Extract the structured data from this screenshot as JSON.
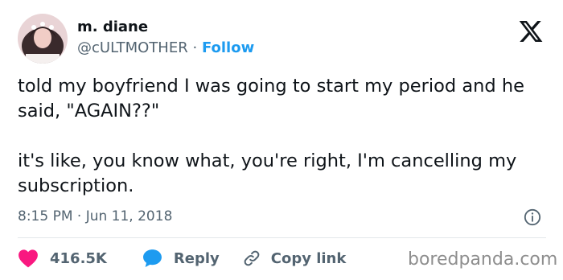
{
  "author": {
    "name": "m. diane",
    "handle": "@cULTMOTHER",
    "separator": "·",
    "follow_label": "Follow"
  },
  "tweet": {
    "paragraphs": [
      "told my boyfriend I was going to start my period and he said, \"AGAIN??\"",
      "it's like, you know what, you're right, I'm cancelling my subscription."
    ],
    "timestamp": "8:15 PM · Jun 11, 2018"
  },
  "actions": {
    "likes": "416.5K",
    "reply_label": "Reply",
    "copy_label": "Copy link"
  },
  "watermark": "boredpanda.com",
  "icons": {
    "logo": "x-logo-icon",
    "info": "info-icon",
    "like": "heart-icon",
    "reply": "speech-bubble-icon",
    "copy": "link-icon"
  },
  "colors": {
    "follow": "#1d9bf0",
    "heart": "#f91880",
    "reply_bubble": "#1d9bf0",
    "text": "#0f1419",
    "secondary": "#536471"
  }
}
